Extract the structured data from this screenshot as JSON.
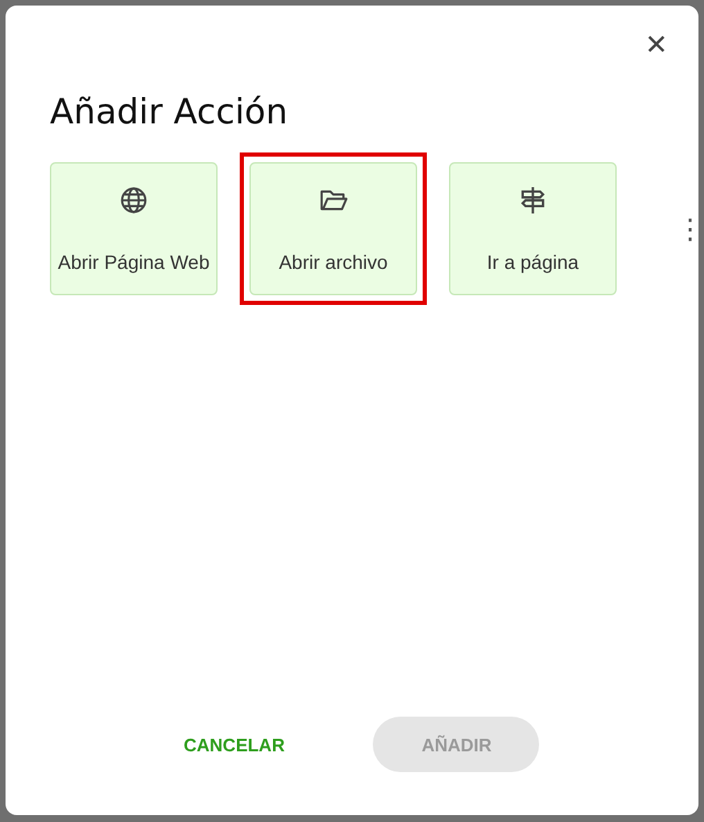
{
  "dialog": {
    "title": "Añadir Acción",
    "close_label": "✕"
  },
  "actions": [
    {
      "kind": "globe",
      "label": "Abrir Página Web",
      "selected": false
    },
    {
      "kind": "folder",
      "label": "Abrir archivo",
      "selected": true
    },
    {
      "kind": "signpost",
      "label": "Ir a página",
      "selected": false
    }
  ],
  "more_label": "⋮",
  "buttons": [
    {
      "kind": "text",
      "label": "CANCELAR",
      "disabled": false
    },
    {
      "kind": "filled",
      "label": "AÑADIR",
      "disabled": true
    }
  ]
}
